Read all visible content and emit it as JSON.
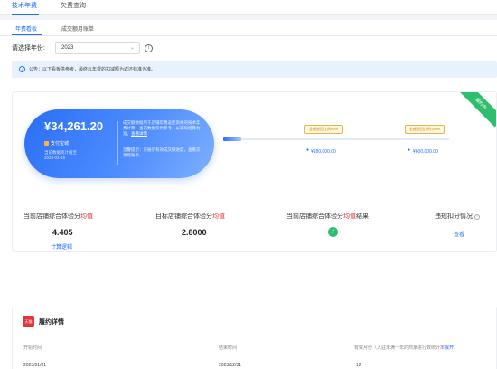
{
  "top_tabs": [
    {
      "label": "技术年费"
    },
    {
      "label": "欠费查询"
    }
  ],
  "sub_tabs": [
    {
      "label": "年费看板"
    },
    {
      "label": "成交额月账单"
    }
  ],
  "year_filter": {
    "label": "请选择年份:",
    "value": "2023"
  },
  "notice": {
    "text": "公告：以下看板供参考，最终以年费的扣减额为返还标准为准。"
  },
  "hero": {
    "amount": "¥34,261.20",
    "brand": "支付宝城",
    "meta_line1": "当前数据统计截至",
    "meta_line2": "2023-03-19",
    "desc": "成交额数据用于店铺年费返还资格的技术年费计算，当前数据仅供参考，以实际结算为准。",
    "desc_link": "查看详情",
    "tip": "温馨提示：只展示有效成交额进度，查看交易月账单。"
  },
  "progress": {
    "fraction": 0.08,
    "milestones": [
      {
        "tag": "全额退回比例50%",
        "value": "¥180,000.00"
      },
      {
        "tag": "全额退回比例100%",
        "value": "¥600,000.00"
      }
    ]
  },
  "ribbon": {
    "label": "履约中"
  },
  "stats": [
    {
      "label_prefix": "当前店铺综合体验分",
      "label_highlight": "均值",
      "label_suffix": "",
      "value": "4.405",
      "link": "计算逻辑"
    },
    {
      "label_prefix": "目标店铺综合体验分",
      "label_highlight": "均值",
      "label_suffix": "",
      "value": "2.8000"
    },
    {
      "label_prefix": "当前店铺综合体验分",
      "label_highlight": "均值",
      "label_suffix": "结果"
    },
    {
      "label_prefix": "违规扣分情况",
      "label_highlight": "",
      "label_suffix": "",
      "link": "查看"
    }
  ],
  "detail": {
    "logo_text": "天猫",
    "title": "履约详情",
    "headers": [
      "开始时间",
      "结束时间"
    ],
    "header3_text": "有效月份（入驻未满一年的商家进行数统计率",
    "header3_link": "展开",
    "header3_tail": "）",
    "values": [
      "2023/01/01",
      "2023/12/31",
      "12"
    ]
  },
  "colors": {
    "primary": "#1f6fff",
    "success": "#2fbd6e",
    "danger": "#e5333c",
    "warning": "#f2b336"
  }
}
